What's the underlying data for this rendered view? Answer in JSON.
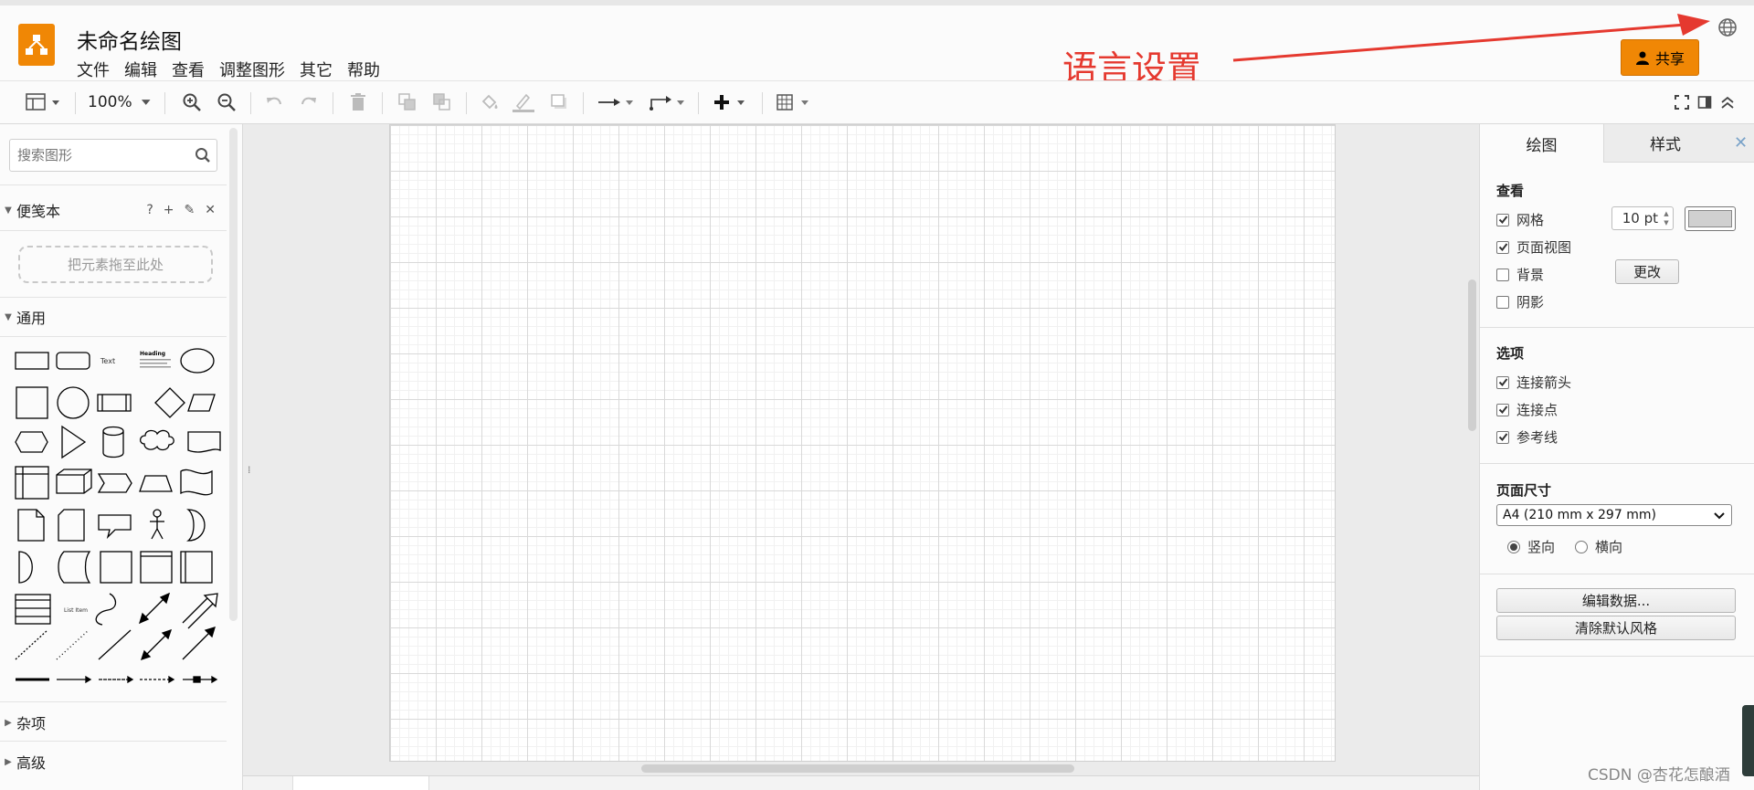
{
  "app": {
    "title": "未命名绘图",
    "menu": [
      "文件",
      "编辑",
      "查看",
      "调整图形",
      "其它",
      "帮助"
    ],
    "annotation": "语言设置",
    "share_label": "共享",
    "colors": {
      "brand": "#f08705",
      "annotation": "#e5392f"
    }
  },
  "toolbar": {
    "zoom": "100%",
    "icons": [
      "format-panel-icon",
      "zoom-in-icon",
      "zoom-out-icon",
      "undo-icon",
      "redo-icon",
      "delete-icon",
      "to-front-icon",
      "to-back-icon",
      "fill-color-icon",
      "line-color-icon",
      "shadow-icon",
      "connection-icon",
      "waypoints-icon",
      "insert-icon",
      "table-icon",
      "fullscreen-icon",
      "format-toggle-icon",
      "collapse-icon"
    ]
  },
  "sidebar": {
    "search_placeholder": "搜索图形",
    "scratchpad": {
      "title": "便笺本",
      "tools": [
        "?",
        "+",
        "✎",
        "✕"
      ],
      "dropzone": "把元素拖至此处"
    },
    "general": {
      "title": "通用"
    },
    "sections": [
      "杂项",
      "高级"
    ],
    "shape_labels": {
      "text": "Text",
      "heading": "Heading",
      "list_item": "List Item"
    }
  },
  "format_panel": {
    "tabs": [
      "绘图",
      "样式"
    ],
    "view": {
      "title": "查看",
      "items": [
        {
          "label": "网格",
          "checked": true
        },
        {
          "label": "页面视图",
          "checked": true
        },
        {
          "label": "背景",
          "checked": false
        },
        {
          "label": "阴影",
          "checked": false
        }
      ],
      "grid_size": "10 pt",
      "change_button": "更改"
    },
    "options": {
      "title": "选项",
      "items": [
        {
          "label": "连接箭头",
          "checked": true
        },
        {
          "label": "连接点",
          "checked": true
        },
        {
          "label": "参考线",
          "checked": true
        }
      ]
    },
    "page_size": {
      "title": "页面尺寸",
      "selected": "A4 (210 mm x 297 mm)",
      "portrait": "竖向",
      "landscape": "横向",
      "orientation": "portrait"
    },
    "buttons": {
      "edit_data": "编辑数据...",
      "clear_style": "清除默认风格"
    }
  },
  "watermark": "CSDN @杏花怎酿酒"
}
